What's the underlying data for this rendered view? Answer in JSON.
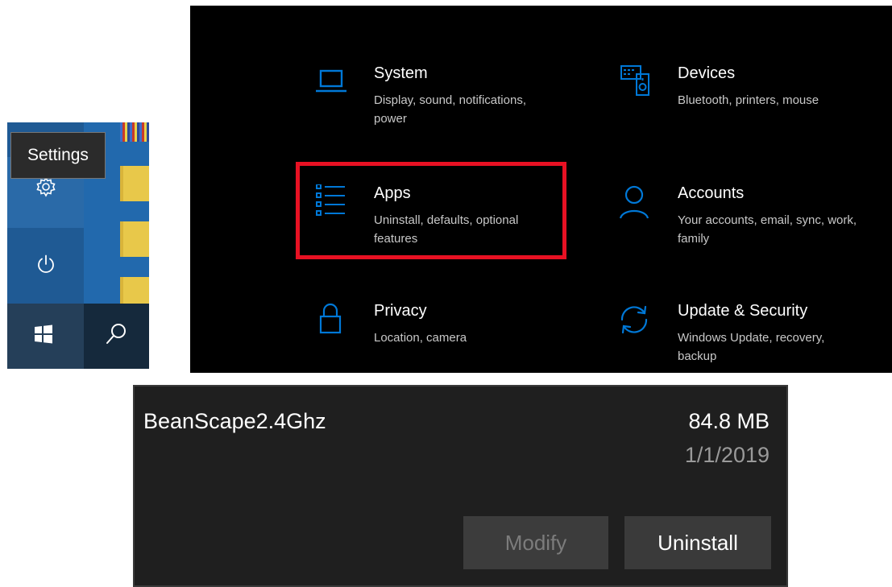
{
  "start_menu": {
    "tooltip": "Settings",
    "icons": [
      "gear-icon",
      "power-icon",
      "windows-logo-icon",
      "search-icon"
    ],
    "colors": {
      "tile_blue": "#1f5a94",
      "taskbar": "#1d3b57",
      "folder": "#e8c84a"
    }
  },
  "settings": {
    "accent_color": "#0078d7",
    "highlight_color": "#e81123",
    "items": [
      {
        "icon": "laptop-icon",
        "title": "System",
        "desc": "Display, sound, notifications, power"
      },
      {
        "icon": "devices-icon",
        "title": "Devices",
        "desc": "Bluetooth, printers, mouse"
      },
      {
        "icon": "apps-list-icon",
        "title": "Apps",
        "desc": "Uninstall, defaults, optional features"
      },
      {
        "icon": "person-icon",
        "title": "Accounts",
        "desc": "Your accounts, email, sync, work, family"
      },
      {
        "icon": "lock-icon",
        "title": "Privacy",
        "desc": "Location, camera"
      },
      {
        "icon": "sync-icon",
        "title": "Update & Security",
        "desc": "Windows Update, recovery, backup"
      }
    ]
  },
  "app_entry": {
    "name": "BeanScape2.4Ghz",
    "size": "84.8 MB",
    "date": "1/1/2019",
    "modify_label": "Modify",
    "uninstall_label": "Uninstall"
  }
}
